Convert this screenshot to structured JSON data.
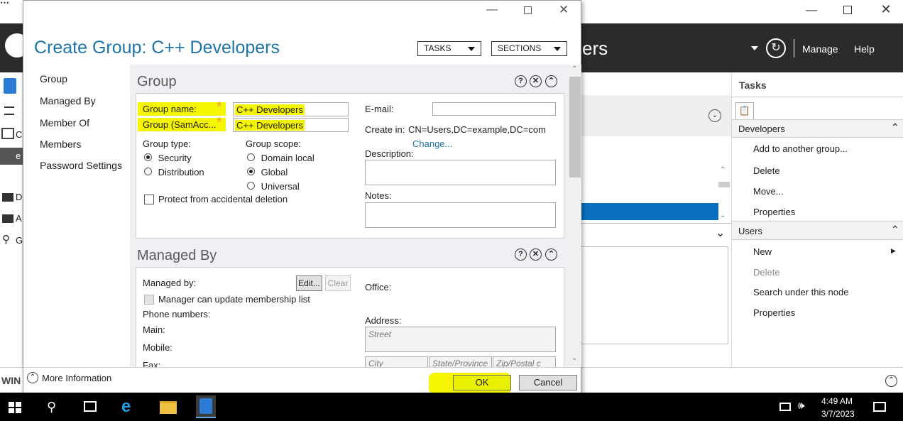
{
  "background_window": {
    "header_title_fragment": "ers",
    "menu": {
      "manage": "Manage",
      "help": "Help"
    },
    "left_icon_letters": [
      "C",
      "e",
      "D",
      "A",
      "G"
    ],
    "footer_text": "WIN",
    "tasks": {
      "title": "Tasks",
      "developers_section": "Developers",
      "developers_items": [
        "Add to another group...",
        "Delete",
        "Move...",
        "Properties"
      ],
      "users_section": "Users",
      "users_items": [
        {
          "label": "New",
          "enabled": true
        },
        {
          "label": "Delete",
          "enabled": false
        },
        {
          "label": "Search under this node",
          "enabled": true
        },
        {
          "label": "Properties",
          "enabled": true
        }
      ]
    }
  },
  "dialog": {
    "title": "Create Group: C++ Developers",
    "tasks_label": "TASKS",
    "sections_label": "SECTIONS",
    "nav": [
      "Group",
      "Managed By",
      "Member Of",
      "Members",
      "Password Settings"
    ],
    "group_section": {
      "title": "Group",
      "group_name_label": "Group name:",
      "group_name_value": "C++ Developers",
      "sam_label": "Group (SamAcc...",
      "sam_value": "C++ Developers",
      "group_type_label": "Group type:",
      "type_options": [
        {
          "label": "Security",
          "selected": true
        },
        {
          "label": "Distribution",
          "selected": false
        }
      ],
      "group_scope_label": "Group scope:",
      "scope_options": [
        {
          "label": "Domain local",
          "selected": false
        },
        {
          "label": "Global",
          "selected": true
        },
        {
          "label": "Universal",
          "selected": false
        }
      ],
      "protect_label": "Protect from accidental deletion",
      "email_label": "E-mail:",
      "create_in_label": "Create in:",
      "create_in_value": "CN=Users,DC=example,DC=com",
      "change_link": "Change...",
      "description_label": "Description:",
      "notes_label": "Notes:"
    },
    "managed_by_section": {
      "title": "Managed By",
      "managed_by_label": "Managed by:",
      "edit_label": "Edit...",
      "clear_label": "Clear",
      "manager_update_label": "Manager can update membership list",
      "phone_numbers_label": "Phone numbers:",
      "main_label": "Main:",
      "mobile_label": "Mobile:",
      "fax_label": "Fax:",
      "office_label": "Office:",
      "address_label": "Address:",
      "street_placeholder": "Street",
      "city_placeholder": "City",
      "state_placeholder": "State/Province",
      "zip_placeholder": "Zip/Postal c"
    },
    "more_information": "More Information",
    "ok_label": "OK",
    "cancel_label": "Cancel"
  },
  "taskbar": {
    "time": "4:49 AM",
    "date": "3/7/2023"
  },
  "colors": {
    "highlight": "#f5f500",
    "accent_blue": "#0a6fbf",
    "title_blue": "#1e73a8",
    "required_star": "#f0a030"
  }
}
